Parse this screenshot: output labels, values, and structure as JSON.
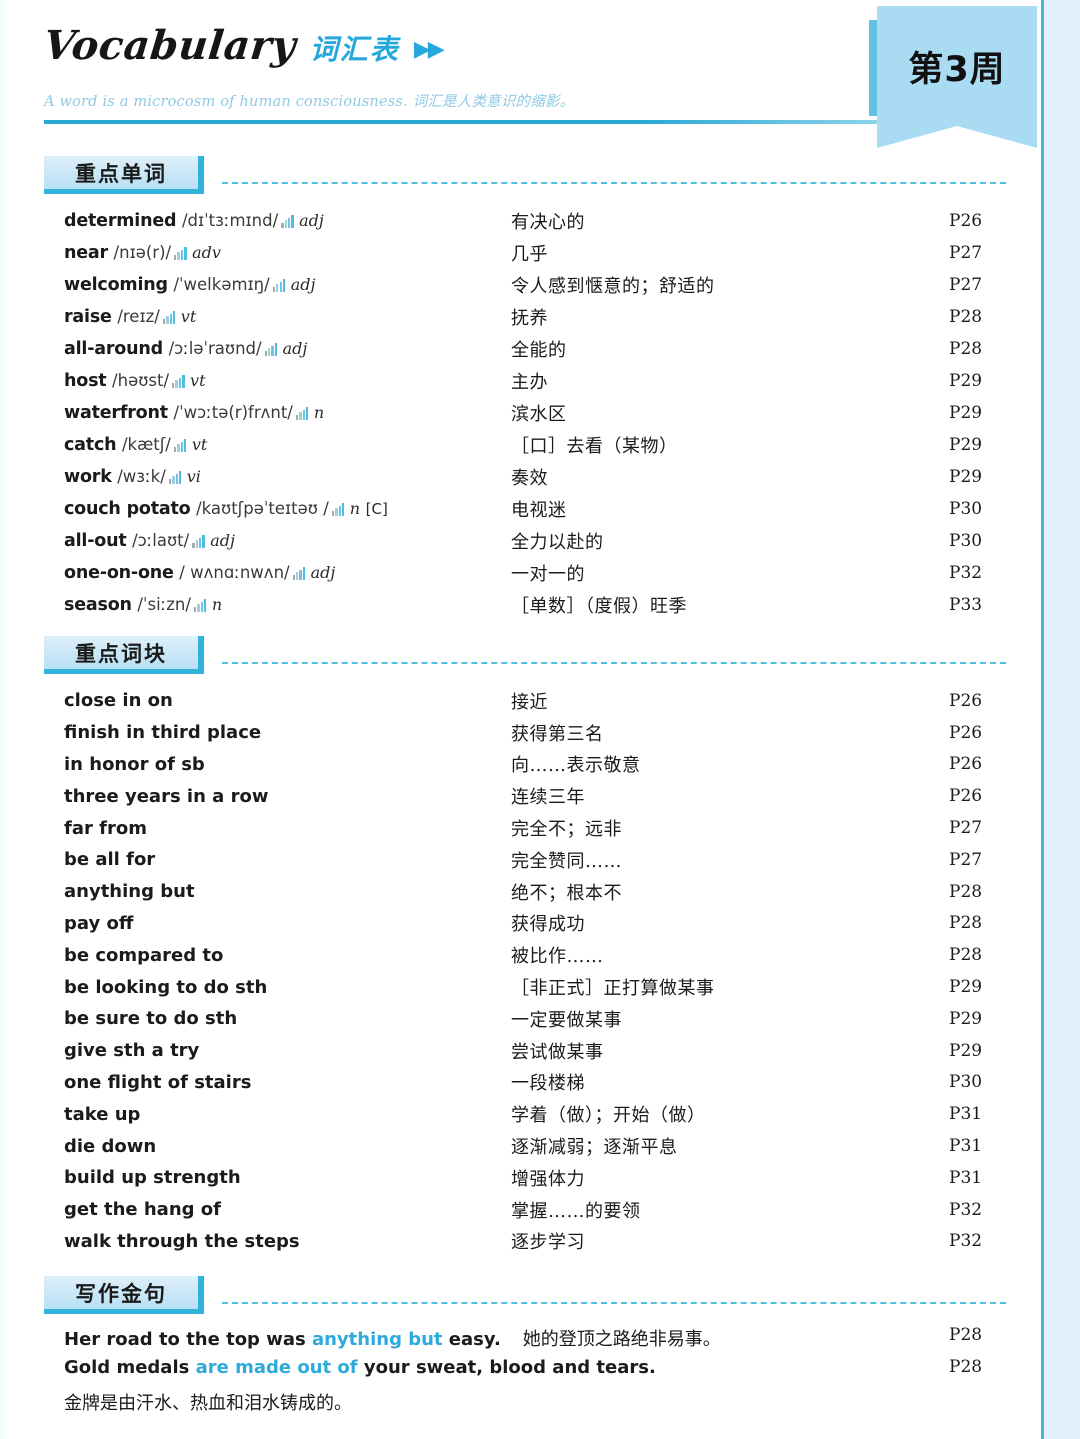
{
  "header": {
    "title_en": "Vocabulary",
    "title_cn": "词汇表",
    "arrows": "▶▶",
    "tagline": "A word is a microcosm of human consciousness. 词汇是人类意识的缩影。",
    "week_badge": "第3周"
  },
  "colors": {
    "accent": "#27a8dc",
    "tab_border": "#30b2da",
    "badge_bg": "#a9dcf3",
    "highlight": "#2eaadc",
    "tagline": "#8fc9e4"
  },
  "sections": {
    "words": {
      "tab_label": "重点单词",
      "entries": [
        {
          "word": "determined",
          "phonetic": "/dɪˈtɜːmɪnd/",
          "pos": "adj",
          "count": "",
          "cn": "有决心的",
          "page": "P26"
        },
        {
          "word": "near",
          "phonetic": "/nɪə(r)/",
          "pos": "adv",
          "count": "",
          "cn": "几乎",
          "page": "P27"
        },
        {
          "word": "welcoming",
          "phonetic": "/ˈwelkəmɪŋ/",
          "pos": "adj",
          "count": "",
          "cn": "令人感到惬意的；舒适的",
          "page": "P27"
        },
        {
          "word": "raise",
          "phonetic": "/reɪz/",
          "pos": "vt",
          "count": "",
          "cn": "抚养",
          "page": "P28"
        },
        {
          "word": "all-around",
          "phonetic": "/ɔːləˈraʊnd/",
          "pos": "adj",
          "count": "",
          "cn": "全能的",
          "page": "P28"
        },
        {
          "word": "host",
          "phonetic": "/həʊst/",
          "pos": "vt",
          "count": "",
          "cn": "主办",
          "page": "P29"
        },
        {
          "word": "waterfront",
          "phonetic": "/ˈwɔːtə(r)frʌnt/",
          "pos": "n",
          "count": "",
          "cn": "滨水区",
          "page": "P29"
        },
        {
          "word": "catch",
          "phonetic": "/kætʃ/",
          "pos": "vt",
          "count": "",
          "cn": "［口］去看（某物）",
          "page": "P29"
        },
        {
          "word": "work",
          "phonetic": "/wɜːk/",
          "pos": "vi",
          "count": "",
          "cn": "奏效",
          "page": "P29"
        },
        {
          "word": "couch potato",
          "phonetic": "/kaʊtʃpəˈteɪtəʊ /",
          "pos": "n",
          "count": "[C]",
          "cn": "电视迷",
          "page": "P30"
        },
        {
          "word": "all-out",
          "phonetic": "/ɔːlaʊt/",
          "pos": "adj",
          "count": "",
          "cn": "全力以赴的",
          "page": "P30"
        },
        {
          "word": "one-on-one",
          "phonetic": "/ wʌnɑːnwʌn/",
          "pos": "adj",
          "count": "",
          "cn": "一对一的",
          "page": "P32"
        },
        {
          "word": "season",
          "phonetic": "/ˈsiːzn/",
          "pos": "n",
          "count": "",
          "cn": "［单数］（度假）旺季",
          "page": "P33"
        }
      ]
    },
    "phrases": {
      "tab_label": "重点词块",
      "entries": [
        {
          "phrase": "close in on",
          "cn": "接近",
          "page": "P26"
        },
        {
          "phrase": "finish in third place",
          "cn": "获得第三名",
          "page": "P26"
        },
        {
          "phrase": "in honor of sb",
          "cn": "向……表示敬意",
          "page": "P26"
        },
        {
          "phrase": "three years in a row",
          "cn": "连续三年",
          "page": "P26"
        },
        {
          "phrase": "far from",
          "cn": "完全不；远非",
          "page": "P27"
        },
        {
          "phrase": "be all for",
          "cn": "完全赞同……",
          "page": "P27"
        },
        {
          "phrase": "anything but",
          "cn": "绝不；根本不",
          "page": "P28"
        },
        {
          "phrase": "pay off",
          "cn": "获得成功",
          "page": "P28"
        },
        {
          "phrase": "be compared to",
          "cn": "被比作……",
          "page": "P28"
        },
        {
          "phrase": "be looking to do sth",
          "cn": "［非正式］正打算做某事",
          "page": "P29"
        },
        {
          "phrase": "be sure to do sth",
          "cn": "一定要做某事",
          "page": "P29"
        },
        {
          "phrase": "give sth a try",
          "cn": "尝试做某事",
          "page": "P29"
        },
        {
          "phrase": "one flight of stairs",
          "cn": "一段楼梯",
          "page": "P30"
        },
        {
          "phrase": "take up",
          "cn": "学着（做）；开始（做）",
          "page": "P31"
        },
        {
          "phrase": "die down",
          "cn": "逐渐减弱；逐渐平息",
          "page": "P31"
        },
        {
          "phrase": "build up strength",
          "cn": "增强体力",
          "page": "P31"
        },
        {
          "phrase": "get the hang of",
          "cn": "掌握……的要领",
          "page": "P32"
        },
        {
          "phrase": "walk through the steps",
          "cn": "逐步学习",
          "page": "P32"
        }
      ]
    },
    "sentences": {
      "tab_label": "写作金句",
      "entries": [
        {
          "pre": "Her road to the top was ",
          "highlight": "anything but",
          "post": " easy.",
          "cn_inline": "她的登顶之路绝非易事。",
          "cn_block": "",
          "page": "P28"
        },
        {
          "pre": "Gold medals ",
          "highlight": "are made out of",
          "post": " your sweat, blood and tears.",
          "cn_inline": "",
          "cn_block": "金牌是由汗水、热血和泪水铸成的。",
          "page": "P28"
        }
      ]
    }
  }
}
